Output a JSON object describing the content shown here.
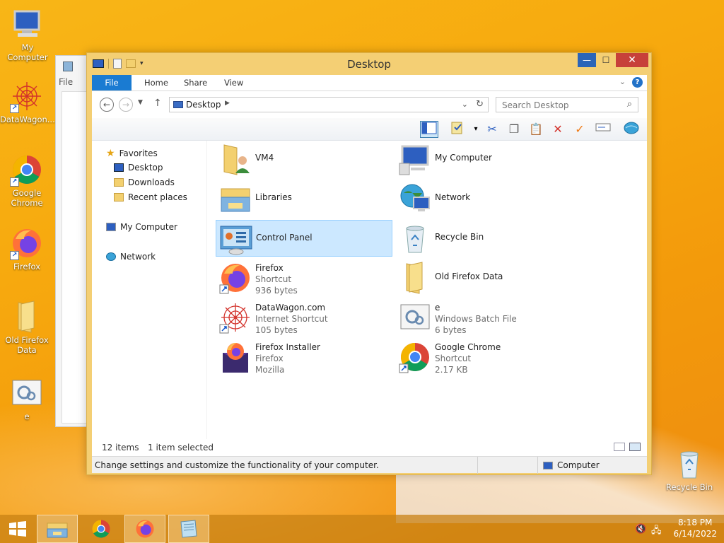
{
  "desktop": {
    "icons": [
      {
        "label": "My Computer"
      },
      {
        "label": "DataWagon...."
      },
      {
        "label": "Google Chrome"
      },
      {
        "label": "Firefox"
      },
      {
        "label": "Old Firefox Data"
      },
      {
        "label": "e"
      },
      {
        "label": "Recycle Bin"
      }
    ]
  },
  "bg_window": {
    "file_tab": "File"
  },
  "window": {
    "title": "Desktop",
    "controls": {
      "minimize": "—",
      "maximize": "☐",
      "close": "✕"
    },
    "ribbon_tabs": [
      "File",
      "Home",
      "Share",
      "View"
    ],
    "address": {
      "location": "Desktop"
    },
    "search": {
      "placeholder": "Search Desktop"
    },
    "nav_pane": {
      "favorites": "Favorites",
      "favorite_items": [
        "Desktop",
        "Downloads",
        "Recent places"
      ],
      "computer": "My Computer",
      "network": "Network"
    },
    "items": [
      {
        "name": "VM4",
        "sub1": "",
        "sub2": ""
      },
      {
        "name": "My Computer",
        "sub1": "",
        "sub2": ""
      },
      {
        "name": "Libraries",
        "sub1": "",
        "sub2": ""
      },
      {
        "name": "Network",
        "sub1": "",
        "sub2": ""
      },
      {
        "name": "Control Panel",
        "sub1": "",
        "sub2": "",
        "selected": true
      },
      {
        "name": "Recycle Bin",
        "sub1": "",
        "sub2": ""
      },
      {
        "name": "Firefox",
        "sub1": "Shortcut",
        "sub2": "936 bytes"
      },
      {
        "name": "Old Firefox Data",
        "sub1": "",
        "sub2": ""
      },
      {
        "name": "DataWagon.com",
        "sub1": "Internet Shortcut",
        "sub2": "105 bytes"
      },
      {
        "name": "e",
        "sub1": "Windows Batch File",
        "sub2": "6 bytes"
      },
      {
        "name": "Firefox Installer",
        "sub1": "Firefox",
        "sub2": "Mozilla"
      },
      {
        "name": "Google Chrome",
        "sub1": "Shortcut",
        "sub2": "2.17 KB"
      }
    ],
    "status": {
      "count": "12 items",
      "selection": "1 item selected"
    },
    "details": {
      "description": "Change settings and customize the functionality of your computer.",
      "location": "Computer"
    }
  },
  "taskbar": {
    "time": "8:18 PM",
    "date": "6/14/2022"
  },
  "colors": {
    "accent": "#1a7bd2",
    "window_frame": "#f4cf74",
    "selection": "#cce8ff"
  }
}
